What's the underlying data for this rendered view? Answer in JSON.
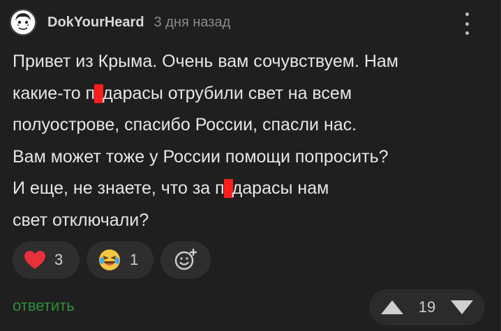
{
  "comment": {
    "author": "DokYourHeard",
    "timestamp": "3 дня назад",
    "lines": [
      {
        "a": "Привет из Крыма. Очень вам сочувствуем. Нам"
      },
      {
        "a": "какие-то п",
        "b": "дарасы отрубили свет на всем"
      },
      {
        "a": "полуострове, спасибо России, спасли нас."
      },
      {
        "a": "Вам может тоже у России помощи попросить?"
      },
      {
        "a": "И еще, не знаете, что за п",
        "b": "дарасы нам"
      },
      {
        "a": "свет отключали?"
      }
    ]
  },
  "reactions": [
    {
      "icon": "heart-icon",
      "count": "3",
      "color": "#e8313a"
    },
    {
      "icon": "laughing-emoji-icon",
      "count": "1",
      "color": "#f5c542"
    }
  ],
  "add_reaction": {
    "icon": "add-emoji-icon"
  },
  "reply_label": "ответить",
  "votes": {
    "score": "19",
    "up_icon": "upvote-triangle-icon",
    "down_icon": "downvote-triangle-icon"
  },
  "colors": {
    "background": "#1f1f1f",
    "accent_green": "#2f8f3a",
    "redaction": "#ff1e1e"
  }
}
